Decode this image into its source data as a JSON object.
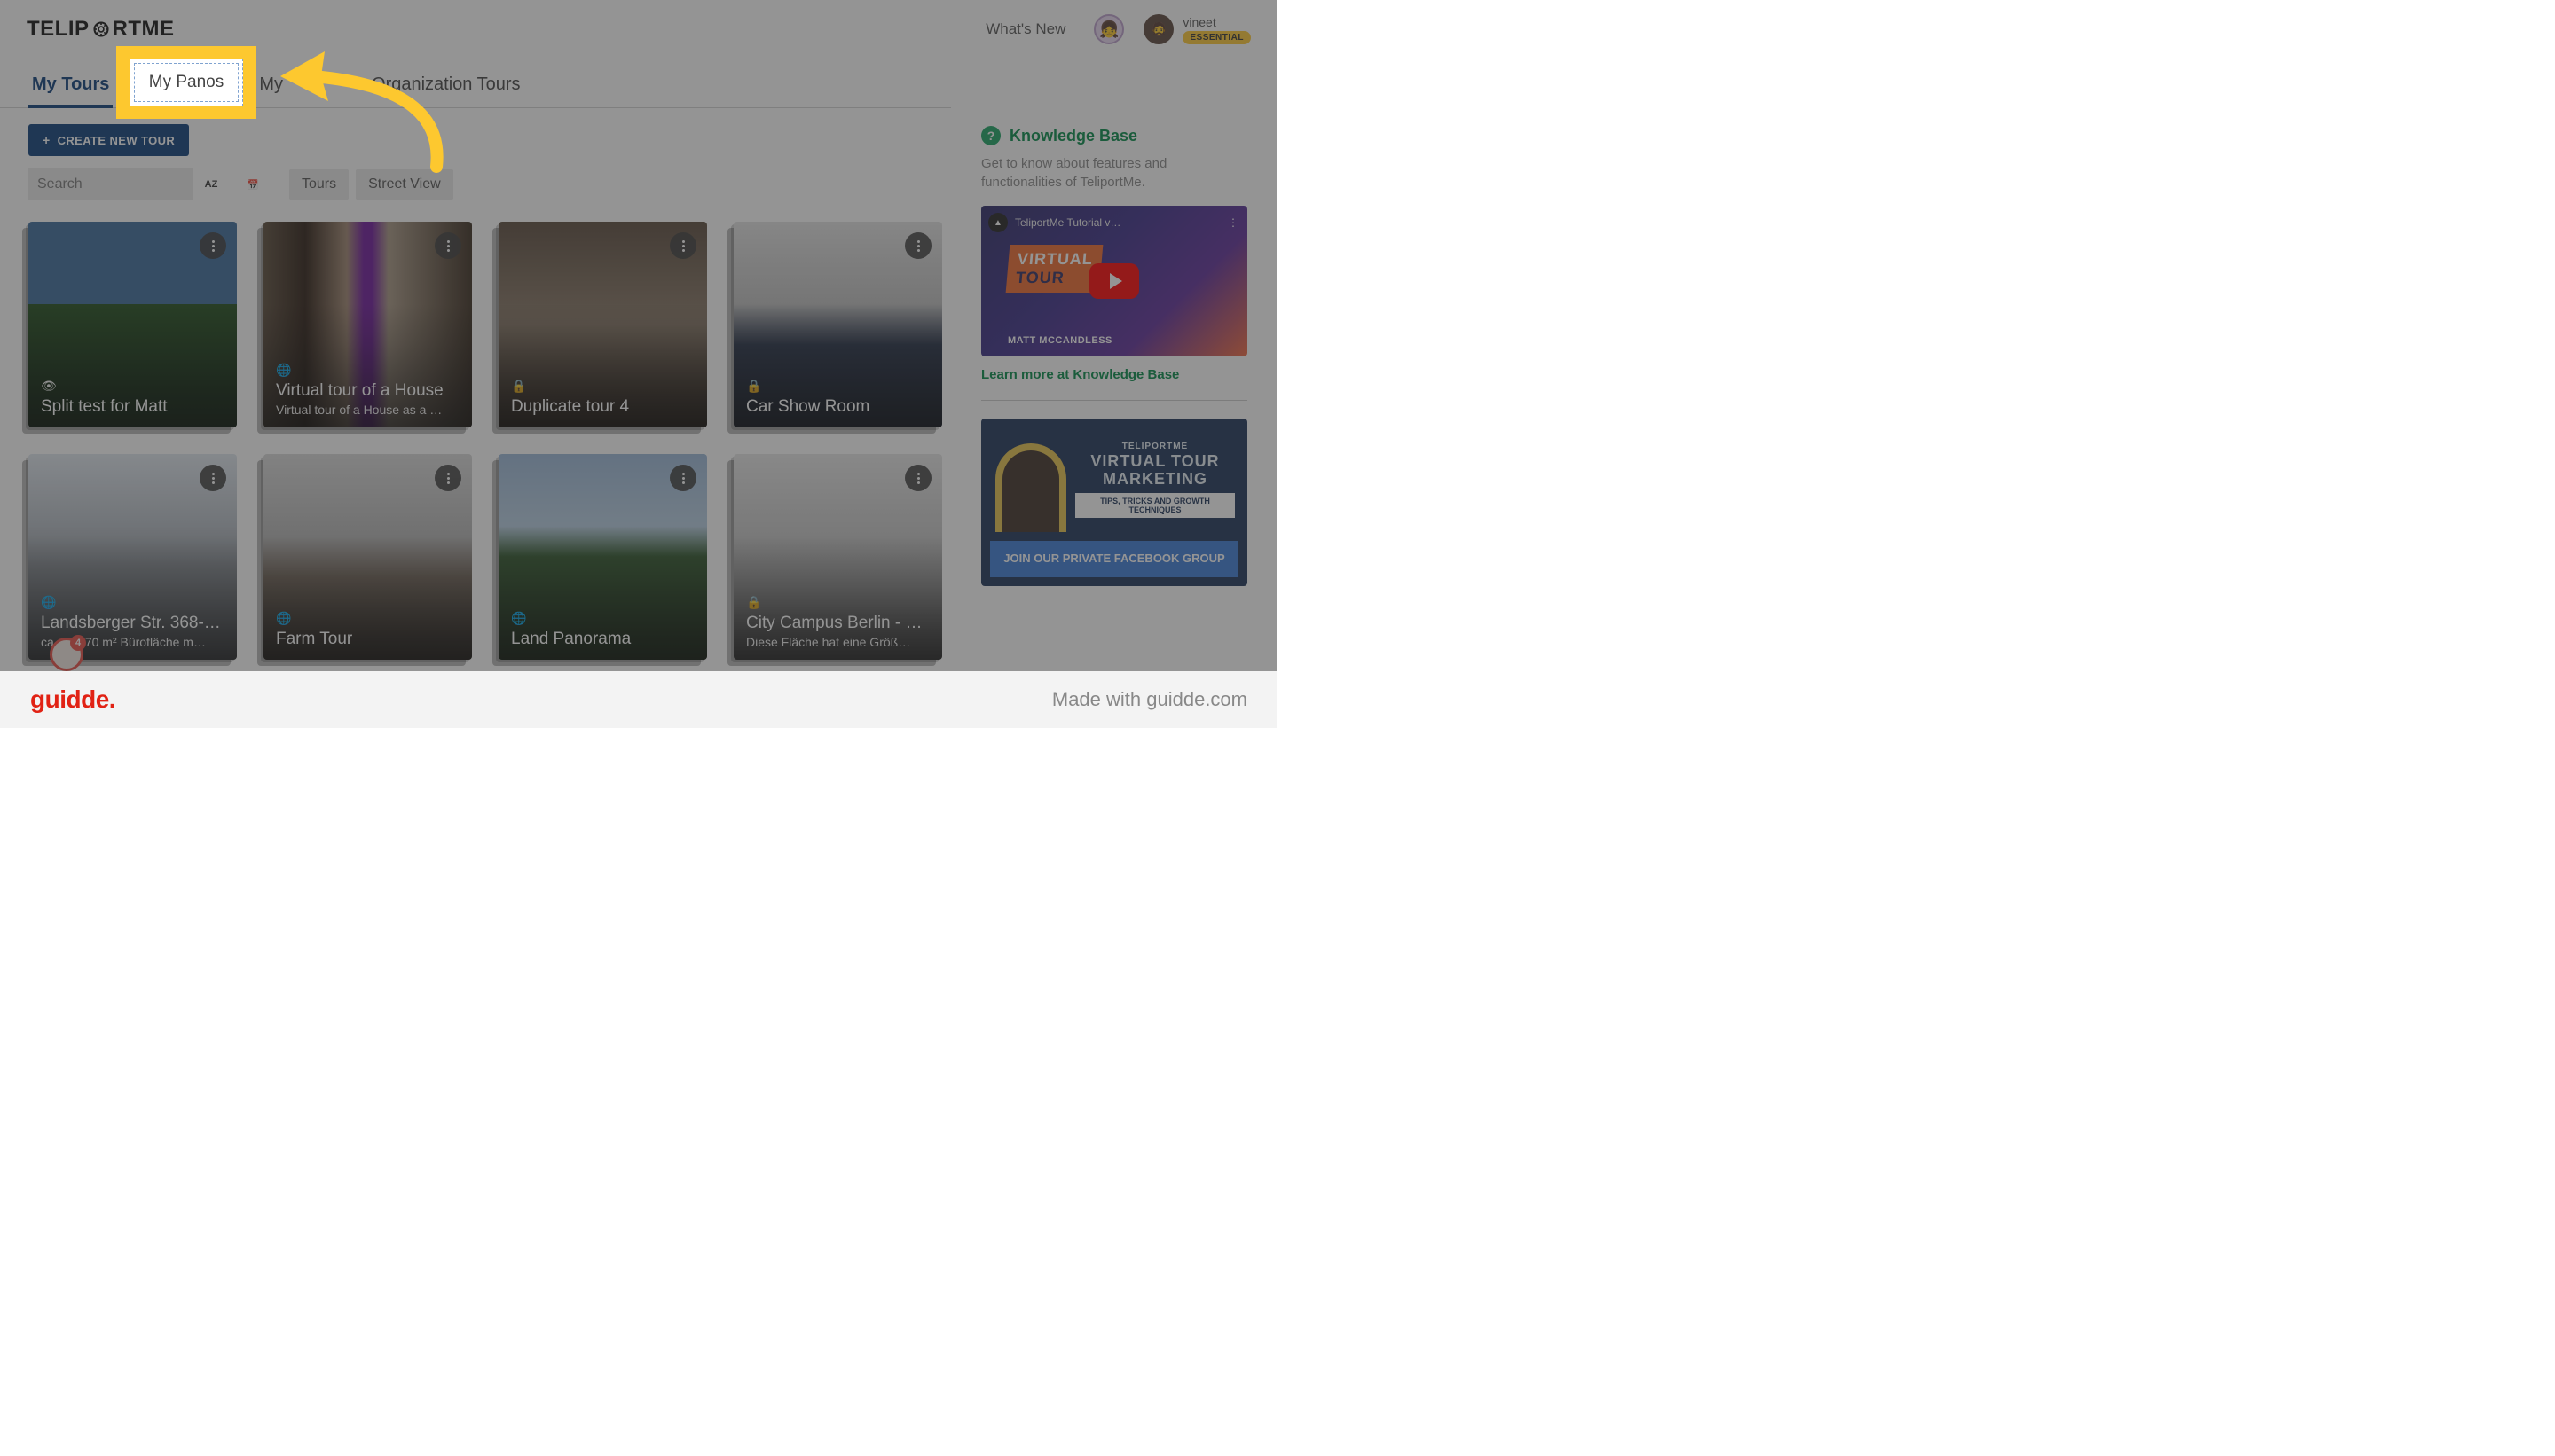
{
  "header": {
    "logo_left": "TELIP",
    "logo_right": "RTME",
    "whats_new": "What's New",
    "user_name": "vineet",
    "user_plan": "ESSENTIAL"
  },
  "tabs": {
    "my_tours": "My Tours",
    "my_panos": "My Panos",
    "my_partial": "My",
    "org_tours": "Organization Tours"
  },
  "toolbar": {
    "create_label": "CREATE NEW TOUR",
    "search_placeholder": "Search",
    "sort_label": "AZ",
    "filter_tours": "Tours",
    "filter_street": "Street View"
  },
  "cards": [
    {
      "icon": "eye",
      "title": "Split test for Matt",
      "sub": ""
    },
    {
      "icon": "globe",
      "title": "Virtual tour of a House",
      "sub": "Virtual tour of a House as a …"
    },
    {
      "icon": "lock",
      "title": "Duplicate tour 4",
      "sub": ""
    },
    {
      "icon": "lock",
      "title": "Car Show Room",
      "sub": ""
    },
    {
      "icon": "globe",
      "title": "Landsberger Str. 368-…",
      "sub": "ca. 390,70 m² Bürofläche m…"
    },
    {
      "icon": "globe",
      "title": "Farm Tour",
      "sub": ""
    },
    {
      "icon": "globe",
      "title": "Land Panorama",
      "sub": ""
    },
    {
      "icon": "lock",
      "title": "City Campus Berlin - …",
      "sub": "Diese Fläche hat eine Größ…"
    }
  ],
  "sidebar": {
    "kb_title": "Knowledge Base",
    "kb_desc": "Get to know about features and functionalities of TeliportMe.",
    "video_channel": "TeliportMe Tutorial v…",
    "video_badge1": "VIRTUAL",
    "video_badge2": "TOUR",
    "video_name": "MATT MCCANDLESS",
    "kb_link": "Learn more at Knowledge Base",
    "fb_brand": "TELIPORTME",
    "fb_title": "VIRTUAL TOUR MARKETING",
    "fb_sub": "TIPS, TRICKS AND GROWTH TECHNIQUES",
    "fb_button": "JOIN OUR PRIVATE FACEBOOK GROUP"
  },
  "highlight": {
    "label": "My Panos"
  },
  "notification_count": "4",
  "footer": {
    "logo": "guidde.",
    "made": "Made with guidde.com"
  },
  "icons": {
    "eye": "👁",
    "globe": "🌐",
    "lock": "🔒",
    "calendar": "📅"
  }
}
